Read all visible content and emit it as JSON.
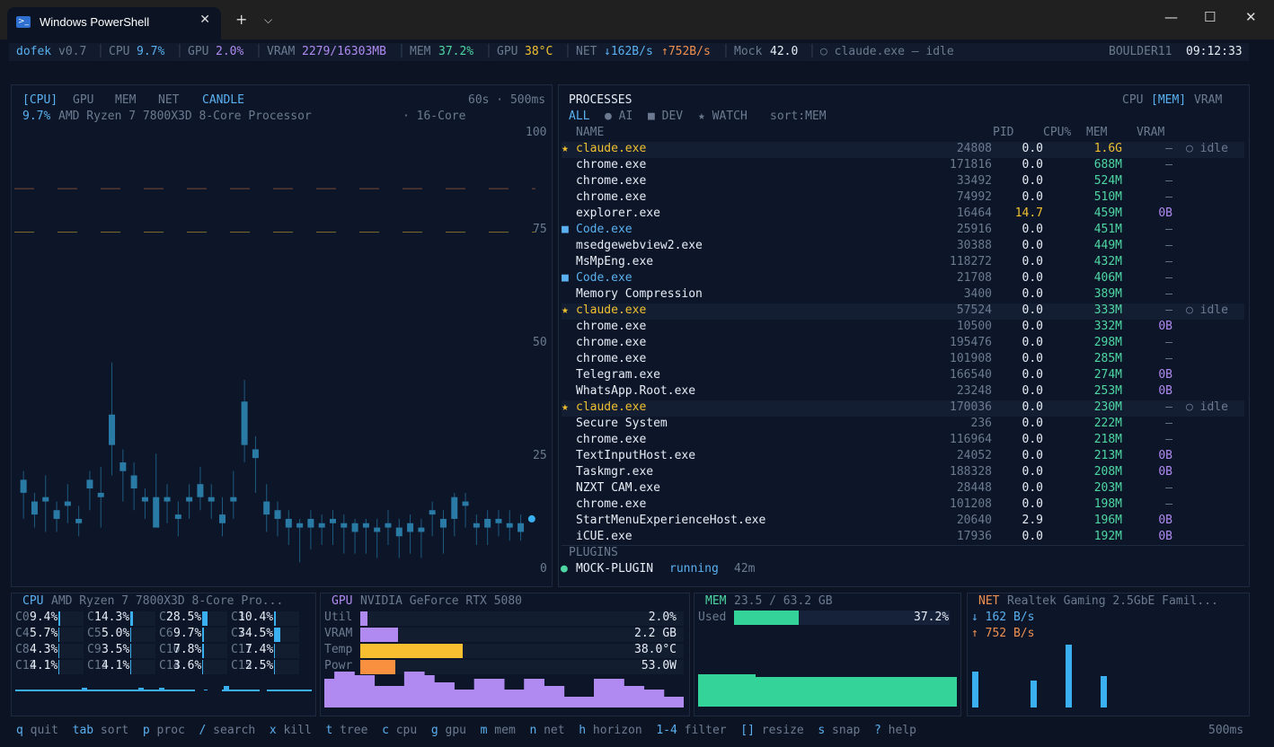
{
  "window": {
    "tab_title": "Windows PowerShell",
    "ps_glyph": ">_"
  },
  "status": {
    "app": "dofek",
    "version": "v0.7",
    "cpu_label": "CPU",
    "cpu_val": "9.7%",
    "gpu_label": "GPU",
    "gpu_val": "2.0%",
    "vram_label": "VRAM",
    "vram_val": "2279/16303MB",
    "mem_label": "MEM",
    "mem_val": "37.2%",
    "gput_label": "GPU",
    "gput_val": "38°C",
    "net_label": "NET",
    "net_down": "↓162B/s",
    "net_up": "↑752B/s",
    "mock_label": "Mock",
    "mock_val": "42.0",
    "claude": "○ claude.exe — idle",
    "host": "BOULDER11",
    "time": "09:12:33"
  },
  "chart_panel": {
    "tabs": [
      "[CPU]",
      "GPU",
      "MEM",
      "NET",
      "CANDLE"
    ],
    "window": "60s · 500ms",
    "cpu_pct": "9.7%",
    "cpu_name": "AMD Ryzen 7 7800X3D 8-Core Processor",
    "cores": "· 16-Core",
    "yticks": [
      "100",
      "75",
      "50",
      "25",
      "0"
    ]
  },
  "chart_data": {
    "type": "candlestick",
    "ylim": [
      0,
      100
    ],
    "yticks": [
      0,
      25,
      50,
      75,
      100
    ],
    "candles": [
      {
        "o": 21,
        "c": 18,
        "h": 23,
        "l": 12
      },
      {
        "o": 16,
        "c": 13,
        "h": 18,
        "l": 10
      },
      {
        "o": 17,
        "c": 16,
        "h": 22,
        "l": 9
      },
      {
        "o": 14,
        "c": 12,
        "h": 16,
        "l": 9
      },
      {
        "o": 16,
        "c": 15,
        "h": 20,
        "l": 11
      },
      {
        "o": 12,
        "c": 11,
        "h": 15,
        "l": 8
      },
      {
        "o": 21,
        "c": 19,
        "h": 23,
        "l": 14
      },
      {
        "o": 18,
        "c": 17,
        "h": 24,
        "l": 10
      },
      {
        "o": 36,
        "c": 29,
        "h": 48,
        "l": 22
      },
      {
        "o": 25,
        "c": 23,
        "h": 28,
        "l": 16
      },
      {
        "o": 22,
        "c": 19,
        "h": 25,
        "l": 14
      },
      {
        "o": 17,
        "c": 16,
        "h": 19,
        "l": 12
      },
      {
        "o": 10,
        "c": 17,
        "h": 27,
        "l": 12
      },
      {
        "o": 17,
        "c": 16,
        "h": 20,
        "l": 11
      },
      {
        "o": 13,
        "c": 12,
        "h": 16,
        "l": 8
      },
      {
        "o": 17,
        "c": 16,
        "h": 20,
        "l": 12
      },
      {
        "o": 20,
        "c": 17,
        "h": 24,
        "l": 14
      },
      {
        "o": 17,
        "c": 16,
        "h": 20,
        "l": 12
      },
      {
        "o": 13,
        "c": 11,
        "h": 17,
        "l": 8
      },
      {
        "o": 17,
        "c": 16,
        "h": 23,
        "l": 12
      },
      {
        "o": 39,
        "c": 29,
        "h": 44,
        "l": 25
      },
      {
        "o": 28,
        "c": 26,
        "h": 31,
        "l": 18
      },
      {
        "o": 16,
        "c": 13,
        "h": 20,
        "l": 9
      },
      {
        "o": 14,
        "c": 12,
        "h": 16,
        "l": 8
      },
      {
        "o": 12,
        "c": 10,
        "h": 14,
        "l": 6
      },
      {
        "o": 11,
        "c": 10,
        "h": 12,
        "l": 2
      },
      {
        "o": 12,
        "c": 10,
        "h": 14,
        "l": 5
      },
      {
        "o": 11,
        "c": 10,
        "h": 13,
        "l": 6
      },
      {
        "o": 12,
        "c": 11,
        "h": 14,
        "l": 6
      },
      {
        "o": 11,
        "c": 10,
        "h": 13,
        "l": 4
      },
      {
        "o": 11,
        "c": 9,
        "h": 12,
        "l": 4
      },
      {
        "o": 11,
        "c": 10,
        "h": 12,
        "l": 4
      },
      {
        "o": 10,
        "c": 9,
        "h": 12,
        "l": 3
      },
      {
        "o": 11,
        "c": 10,
        "h": 14,
        "l": 6
      },
      {
        "o": 10,
        "c": 8,
        "h": 12,
        "l": 3
      },
      {
        "o": 11,
        "c": 9,
        "h": 13,
        "l": 4
      },
      {
        "o": 10,
        "c": 9,
        "h": 12,
        "l": 3
      },
      {
        "o": 14,
        "c": 13,
        "h": 16,
        "l": 8
      },
      {
        "o": 12,
        "c": 10,
        "h": 14,
        "l": 4
      },
      {
        "o": 17,
        "c": 12,
        "h": 18,
        "l": 8
      },
      {
        "o": 16,
        "c": 15,
        "h": 18,
        "l": 10
      },
      {
        "o": 11,
        "c": 10,
        "h": 13,
        "l": 6
      },
      {
        "o": 12,
        "c": 10,
        "h": 14,
        "l": 6
      },
      {
        "o": 12,
        "c": 11,
        "h": 14,
        "l": 8
      },
      {
        "o": 11,
        "c": 10,
        "h": 14,
        "l": 7
      },
      {
        "o": 11,
        "c": 9,
        "h": 13,
        "l": 7
      },
      {
        "o": 12,
        "c": 12,
        "h": 12,
        "l": 12
      }
    ],
    "dashed_levels": [
      88,
      78
    ]
  },
  "proc_panel": {
    "title": "PROCESSES",
    "modes": [
      "CPU",
      "[MEM]",
      "VRAM"
    ],
    "filters": [
      "ALL",
      "● AI",
      "■ DEV",
      "★ WATCH",
      "sort:MEM"
    ],
    "headers": {
      "name": "NAME",
      "pid": "PID",
      "cpu": "CPU%",
      "mem": "MEM",
      "vram": "VRAM"
    },
    "rows": [
      {
        "mark": "★",
        "mc": "yel",
        "name": "claude.exe",
        "nc": "yel",
        "pid": "24808",
        "cpu": "0.0",
        "cc": "wht",
        "mem": "1.6G",
        "mmc": "yel",
        "vram": "—",
        "status": "○ idle",
        "hl": true
      },
      {
        "mark": "",
        "mc": "",
        "name": "chrome.exe",
        "nc": "wht",
        "pid": "171816",
        "cpu": "0.0",
        "cc": "wht",
        "mem": "688M",
        "mmc": "grn",
        "vram": "—",
        "status": ""
      },
      {
        "mark": "",
        "mc": "",
        "name": "chrome.exe",
        "nc": "wht",
        "pid": "33492",
        "cpu": "0.0",
        "cc": "wht",
        "mem": "524M",
        "mmc": "grn",
        "vram": "—",
        "status": ""
      },
      {
        "mark": "",
        "mc": "",
        "name": "chrome.exe",
        "nc": "wht",
        "pid": "74992",
        "cpu": "0.0",
        "cc": "wht",
        "mem": "510M",
        "mmc": "grn",
        "vram": "—",
        "status": ""
      },
      {
        "mark": "",
        "mc": "",
        "name": "explorer.exe",
        "nc": "wht",
        "pid": "16464",
        "cpu": "14.7",
        "cc": "yel",
        "mem": "459M",
        "mmc": "grn",
        "vram": "0B",
        "status": ""
      },
      {
        "mark": "■",
        "mc": "blue",
        "name": "Code.exe",
        "nc": "blue",
        "pid": "25916",
        "cpu": "0.0",
        "cc": "wht",
        "mem": "451M",
        "mmc": "grn",
        "vram": "—",
        "status": ""
      },
      {
        "mark": "",
        "mc": "",
        "name": "msedgewebview2.exe",
        "nc": "wht",
        "pid": "30388",
        "cpu": "0.0",
        "cc": "wht",
        "mem": "449M",
        "mmc": "grn",
        "vram": "—",
        "status": ""
      },
      {
        "mark": "",
        "mc": "",
        "name": "MsMpEng.exe",
        "nc": "wht",
        "pid": "118272",
        "cpu": "0.0",
        "cc": "wht",
        "mem": "432M",
        "mmc": "grn",
        "vram": "—",
        "status": ""
      },
      {
        "mark": "■",
        "mc": "blue",
        "name": "Code.exe",
        "nc": "blue",
        "pid": "21708",
        "cpu": "0.0",
        "cc": "wht",
        "mem": "406M",
        "mmc": "grn",
        "vram": "—",
        "status": ""
      },
      {
        "mark": "",
        "mc": "",
        "name": "Memory Compression",
        "nc": "wht",
        "pid": "3400",
        "cpu": "0.0",
        "cc": "wht",
        "mem": "389M",
        "mmc": "grn",
        "vram": "—",
        "status": ""
      },
      {
        "mark": "★",
        "mc": "yel",
        "name": "claude.exe",
        "nc": "yel",
        "pid": "57524",
        "cpu": "0.0",
        "cc": "wht",
        "mem": "333M",
        "mmc": "grn",
        "vram": "—",
        "status": "○ idle",
        "hl": true
      },
      {
        "mark": "",
        "mc": "",
        "name": "chrome.exe",
        "nc": "wht",
        "pid": "10500",
        "cpu": "0.0",
        "cc": "wht",
        "mem": "332M",
        "mmc": "grn",
        "vram": "0B",
        "status": ""
      },
      {
        "mark": "",
        "mc": "",
        "name": "chrome.exe",
        "nc": "wht",
        "pid": "195476",
        "cpu": "0.0",
        "cc": "wht",
        "mem": "298M",
        "mmc": "grn",
        "vram": "—",
        "status": ""
      },
      {
        "mark": "",
        "mc": "",
        "name": "chrome.exe",
        "nc": "wht",
        "pid": "101908",
        "cpu": "0.0",
        "cc": "wht",
        "mem": "285M",
        "mmc": "grn",
        "vram": "—",
        "status": ""
      },
      {
        "mark": "",
        "mc": "",
        "name": "Telegram.exe",
        "nc": "wht",
        "pid": "166540",
        "cpu": "0.0",
        "cc": "wht",
        "mem": "274M",
        "mmc": "grn",
        "vram": "0B",
        "status": ""
      },
      {
        "mark": "",
        "mc": "",
        "name": "WhatsApp.Root.exe",
        "nc": "wht",
        "pid": "23248",
        "cpu": "0.0",
        "cc": "wht",
        "mem": "253M",
        "mmc": "grn",
        "vram": "0B",
        "status": ""
      },
      {
        "mark": "★",
        "mc": "yel",
        "name": "claude.exe",
        "nc": "yel",
        "pid": "170036",
        "cpu": "0.0",
        "cc": "wht",
        "mem": "230M",
        "mmc": "grn",
        "vram": "—",
        "status": "○ idle",
        "hl": true
      },
      {
        "mark": "",
        "mc": "",
        "name": "Secure System",
        "nc": "wht",
        "pid": "236",
        "cpu": "0.0",
        "cc": "wht",
        "mem": "222M",
        "mmc": "grn",
        "vram": "—",
        "status": ""
      },
      {
        "mark": "",
        "mc": "",
        "name": "chrome.exe",
        "nc": "wht",
        "pid": "116964",
        "cpu": "0.0",
        "cc": "wht",
        "mem": "218M",
        "mmc": "grn",
        "vram": "—",
        "status": ""
      },
      {
        "mark": "",
        "mc": "",
        "name": "TextInputHost.exe",
        "nc": "wht",
        "pid": "24052",
        "cpu": "0.0",
        "cc": "wht",
        "mem": "213M",
        "mmc": "grn",
        "vram": "0B",
        "status": ""
      },
      {
        "mark": "",
        "mc": "",
        "name": "Taskmgr.exe",
        "nc": "wht",
        "pid": "188328",
        "cpu": "0.0",
        "cc": "wht",
        "mem": "208M",
        "mmc": "grn",
        "vram": "0B",
        "status": ""
      },
      {
        "mark": "",
        "mc": "",
        "name": "NZXT CAM.exe",
        "nc": "wht",
        "pid": "28448",
        "cpu": "0.0",
        "cc": "wht",
        "mem": "203M",
        "mmc": "grn",
        "vram": "—",
        "status": ""
      },
      {
        "mark": "",
        "mc": "",
        "name": "chrome.exe",
        "nc": "wht",
        "pid": "101208",
        "cpu": "0.0",
        "cc": "wht",
        "mem": "198M",
        "mmc": "grn",
        "vram": "—",
        "status": ""
      },
      {
        "mark": "",
        "mc": "",
        "name": "StartMenuExperienceHost.exe",
        "nc": "wht",
        "pid": "20640",
        "cpu": "2.9",
        "cc": "wht",
        "mem": "196M",
        "mmc": "grn",
        "vram": "0B",
        "status": ""
      },
      {
        "mark": "",
        "mc": "",
        "name": "iCUE.exe",
        "nc": "wht",
        "pid": "17936",
        "cpu": "0.0",
        "cc": "wht",
        "mem": "192M",
        "mmc": "grn",
        "vram": "0B",
        "status": ""
      }
    ],
    "plugins_title": "PLUGINS",
    "plugin": {
      "dot": "●",
      "name": "MOCK-PLUGIN",
      "state": "running",
      "age": "42m"
    }
  },
  "cpu_mini": {
    "title": "CPU",
    "name": "AMD Ryzen 7 7800X3D 8-Core Pro...",
    "cores": [
      {
        "l": "C0",
        "v": "9.4%",
        "f": 0.094
      },
      {
        "l": "C1",
        "v": "14.3%",
        "f": 0.143
      },
      {
        "l": "C2",
        "v": "28.5%",
        "f": 0.285
      },
      {
        "l": "C3",
        "v": "10.4%",
        "f": 0.104
      },
      {
        "l": "C4",
        "v": "5.7%",
        "f": 0.057
      },
      {
        "l": "C5",
        "v": "5.0%",
        "f": 0.05
      },
      {
        "l": "C6",
        "v": "9.7%",
        "f": 0.097
      },
      {
        "l": "C7",
        "v": "34.5%",
        "f": 0.345
      },
      {
        "l": "C8",
        "v": "4.3%",
        "f": 0.043
      },
      {
        "l": "C9",
        "v": "3.5%",
        "f": 0.035
      },
      {
        "l": "C10",
        "v": "7.8%",
        "f": 0.078
      },
      {
        "l": "C11",
        "v": "7.4%",
        "f": 0.074
      },
      {
        "l": "C12",
        "v": "4.1%",
        "f": 0.041
      },
      {
        "l": "C13",
        "v": "4.1%",
        "f": 0.041
      },
      {
        "l": "C14",
        "v": "3.6%",
        "f": 0.036
      },
      {
        "l": "C15",
        "v": "2.5%",
        "f": 0.025
      }
    ]
  },
  "gpu_mini": {
    "title": "GPU",
    "name": "NVIDIA GeForce RTX 5080",
    "rows": [
      {
        "l": "Util",
        "v": "2.0%",
        "f": 0.02,
        "c": "#b08af0"
      },
      {
        "l": "VRAM",
        "v": "2.2 GB",
        "f": 0.14,
        "c": "#b08af0"
      },
      {
        "l": "Temp",
        "v": "38.0°C",
        "f": 0.38,
        "c": "#f8c030"
      },
      {
        "l": "Powr",
        "v": "53.0W",
        "f": 0.13,
        "c": "#f89040"
      }
    ],
    "history": [
      8,
      10,
      10,
      9,
      9,
      6,
      6,
      6,
      10,
      10,
      9,
      7,
      7,
      5,
      5,
      8,
      8,
      8,
      5,
      5,
      8,
      8,
      6,
      6,
      3,
      3,
      3,
      8,
      8,
      8,
      6,
      6,
      5,
      5,
      3,
      3
    ]
  },
  "mem_mini": {
    "title": "MEM",
    "sub": "23.5 / 63.2 GB",
    "used_label": "Used",
    "used_val": "37.2%",
    "used_frac": 0.372
  },
  "net_mini": {
    "title": "NET",
    "name": "Realtek Gaming 2.5GbE Famil...",
    "down": "↓ 162 B/s",
    "up": "↑ 752 B/s",
    "bars": [
      4,
      0,
      0,
      0,
      0,
      3,
      0,
      0,
      7,
      0,
      0,
      3.5
    ]
  },
  "footer": {
    "keys": [
      {
        "k": "q",
        "d": "quit"
      },
      {
        "k": "tab",
        "d": "sort"
      },
      {
        "k": "p",
        "d": "proc"
      },
      {
        "k": "/",
        "d": "search"
      },
      {
        "k": "x",
        "d": "kill"
      },
      {
        "k": "t",
        "d": "tree"
      },
      {
        "k": "c",
        "d": "cpu"
      },
      {
        "k": "g",
        "d": "gpu"
      },
      {
        "k": "m",
        "d": "mem"
      },
      {
        "k": "n",
        "d": "net"
      },
      {
        "k": "h",
        "d": "horizon"
      },
      {
        "k": "1-4",
        "d": "filter"
      },
      {
        "k": "[]",
        "d": "resize"
      },
      {
        "k": "s",
        "d": "snap"
      },
      {
        "k": "?",
        "d": "help"
      }
    ],
    "rate": "500ms"
  }
}
